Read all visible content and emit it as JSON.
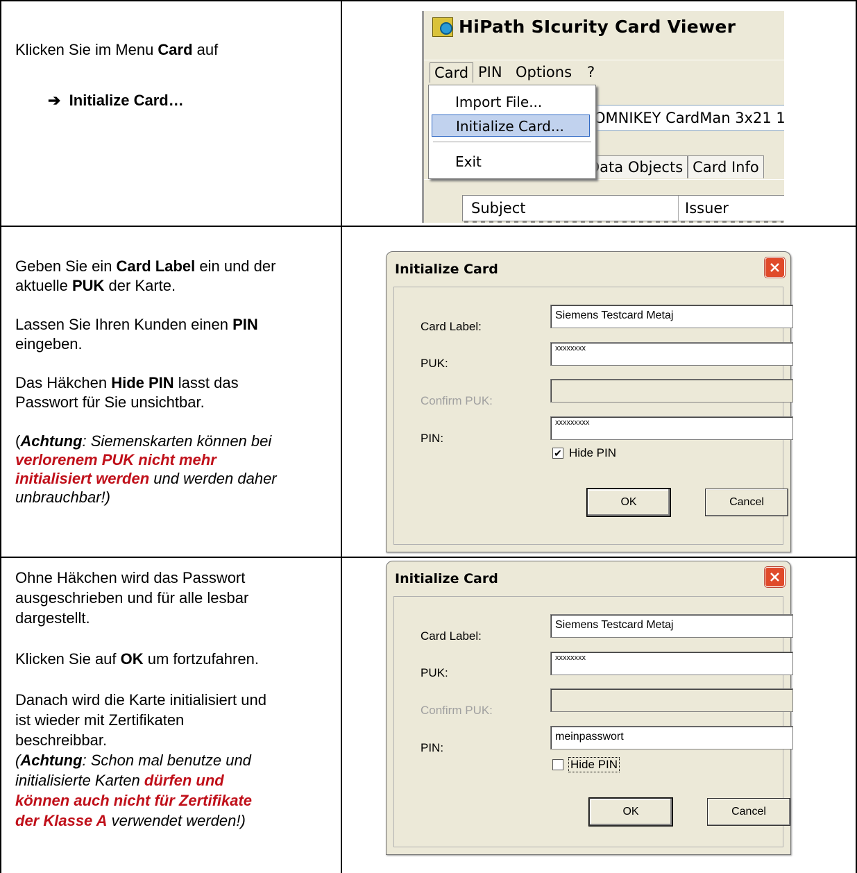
{
  "rows": [
    {
      "instr": {
        "line1_pre": "Klicken Sie im Menu ",
        "line1_bold": "Card",
        "line1_post": " auf",
        "arrow": "➔",
        "step": "Initialize Card…"
      }
    },
    {
      "instr": {
        "p1_pre": "Geben Sie ein ",
        "p1_bold1": "Card Label",
        "p1_mid": " ein und der",
        "p1_line2_pre": "aktuelle ",
        "p1_bold2": "PUK",
        "p1_post": " der Karte.",
        "p2_pre": "Lassen Sie Ihren Kunden einen ",
        "p2_bold": "PIN",
        "p2_post": "eingeben.",
        "p3_pre": "Das Häkchen ",
        "p3_bold": "Hide PIN",
        "p3_post": " lasst das",
        "p3_line2": "Passwort für Sie unsichtbar.",
        "warn_open": "(",
        "warn_bold": "Achtung",
        "warn_text1": ": Siemenskarten können bei",
        "warn_red1": "verlorenem PUK nicht mehr",
        "warn_red2": "initialisiert werden",
        "warn_text2": " und werden daher",
        "warn_text3": "unbrauchbar!)"
      }
    },
    {
      "instr": {
        "p1_l1": "Ohne Häkchen wird das Passwort",
        "p1_l2": "ausgeschrieben und für alle lesbar",
        "p1_l3": "dargestellt.",
        "p2_pre": "Klicken Sie auf ",
        "p2_bold": "OK",
        "p2_post": " um fortzufahren.",
        "p3_l1": "Danach wird die Karte initialisiert und",
        "p3_l2": "ist wieder mit Zertifikaten",
        "p3_l3": "beschreibbar.",
        "warn_open": "(",
        "warn_bold": "Achtung",
        "warn_text1": ": Schon mal benutze und",
        "warn_text2": "initialisierte Karten ",
        "warn_red1": "dürfen und",
        "warn_red2": "können auch nicht für Zertifikate",
        "warn_red3": "der Klasse A",
        "warn_text3": " verwendet werden!)"
      }
    }
  ],
  "viewer": {
    "title": "HiPath SIcurity Card Viewer",
    "menu": [
      "Card",
      "PIN",
      "Options",
      "?"
    ],
    "dropdown": [
      "Import File...",
      "Initialize Card...",
      "Exit"
    ],
    "reader_text": "OMNIKEY CardMan 3x21 1",
    "tabs": [
      "Data Objects",
      "Card Info"
    ],
    "columns": [
      "Subject",
      "Issuer"
    ]
  },
  "dialog1": {
    "title": "Initialize Card",
    "card_label_lbl": "Card Label:",
    "card_label_val": "Siemens Testcard Metaj",
    "puk_lbl": "PUK:",
    "puk_val": "xxxxxxxx",
    "confirm_lbl": "Confirm PUK:",
    "pin_lbl": "PIN:",
    "pin_val": "xxxxxxxxx",
    "hide_pin": "Hide PIN",
    "hide_pin_checked": true,
    "ok": "OK",
    "cancel": "Cancel"
  },
  "dialog2": {
    "title": "Initialize Card",
    "card_label_lbl": "Card Label:",
    "card_label_val": "Siemens Testcard Metaj",
    "puk_lbl": "PUK:",
    "puk_val": "xxxxxxxx",
    "confirm_lbl": "Confirm PUK:",
    "pin_lbl": "PIN:",
    "pin_val": "meinpasswort",
    "hide_pin": "Hide PIN",
    "hide_pin_checked": false,
    "ok": "OK",
    "cancel": "Cancel"
  },
  "colors": {
    "warning_red": "#c0101a",
    "dialog_bg": "#ece9d8",
    "close_btn": "#e04a2a"
  }
}
